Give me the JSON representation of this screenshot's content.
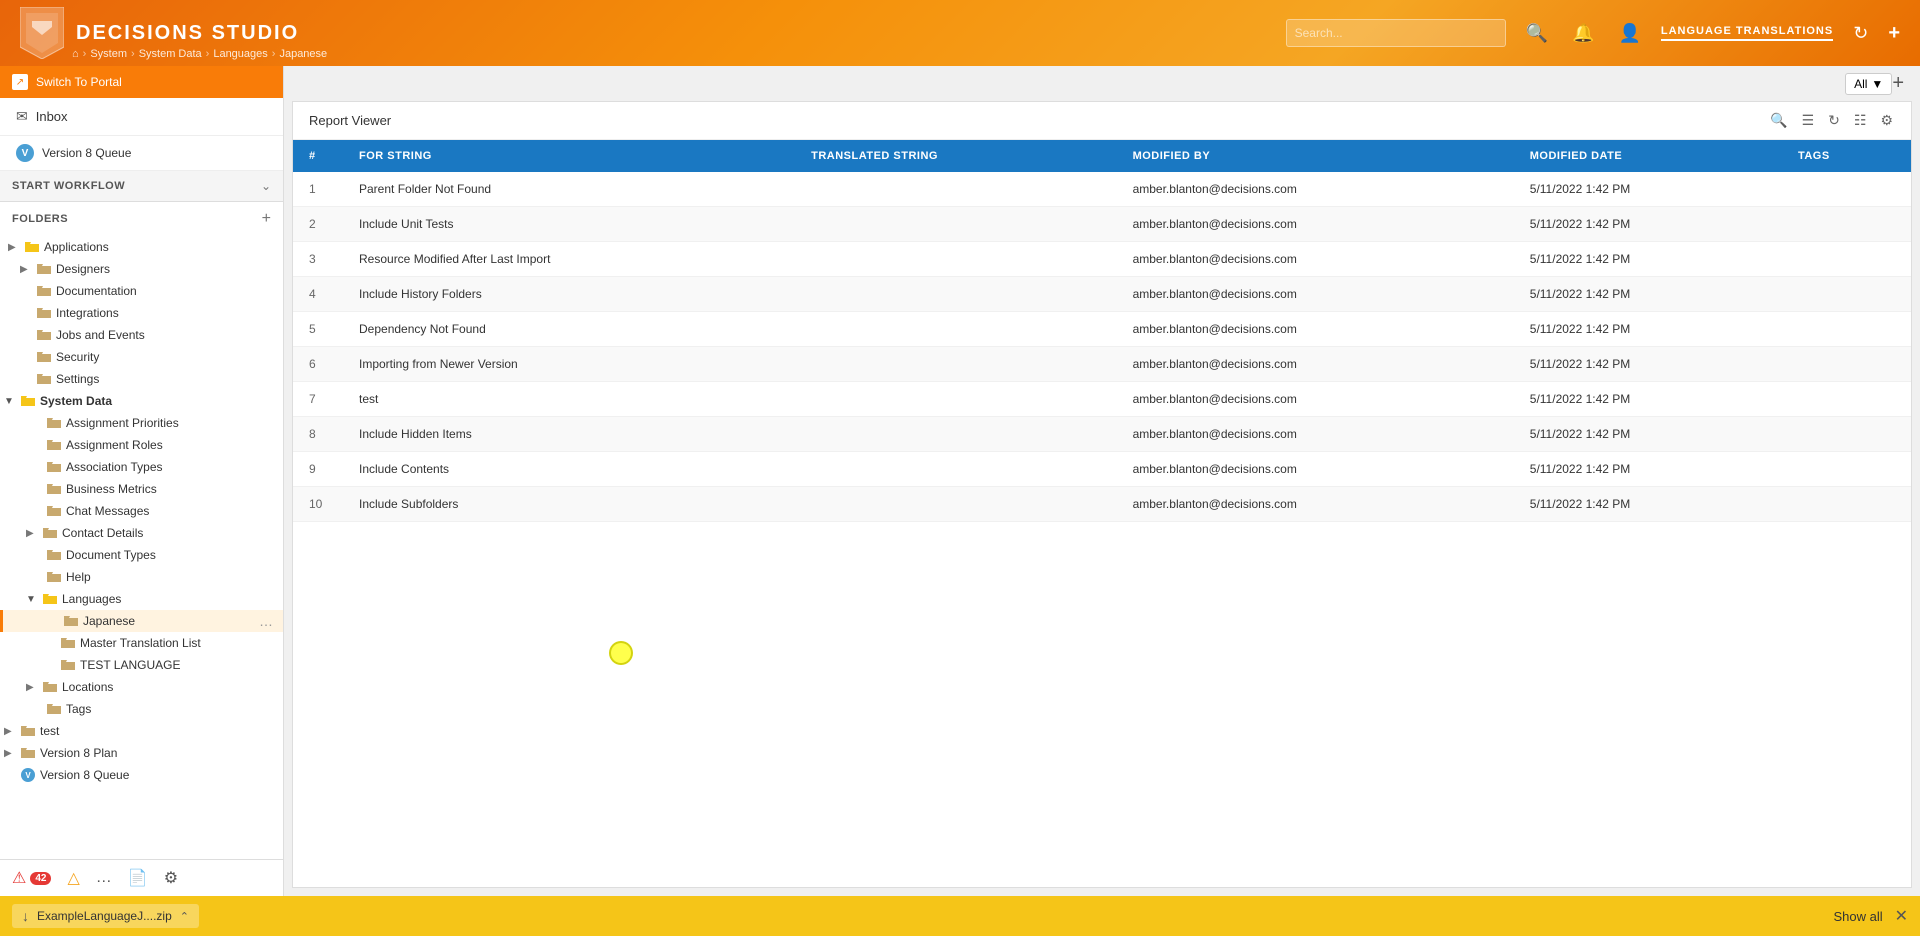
{
  "app": {
    "title": "DECISIONS STUDIO"
  },
  "header": {
    "title": "DECISIONS STUDIO",
    "search_placeholder": "Search...",
    "lang_translations_label": "LANGUAGE TRANSLATIONS",
    "all_label": "All",
    "refresh_icon": "↺"
  },
  "breadcrumb": {
    "home": "⌂",
    "system": "System",
    "system_data": "System Data",
    "languages": "Languages",
    "japanese": "Japanese"
  },
  "sidebar": {
    "switch_portal": "Switch To Portal",
    "inbox": "Inbox",
    "version_queue": "Version 8 Queue",
    "start_workflow": "START WORKFLOW",
    "folders_label": "FOLDERS",
    "items": [
      {
        "id": "applications",
        "label": "Applications",
        "level": 0,
        "expandable": true,
        "expanded": false
      },
      {
        "id": "designers",
        "label": "Designers",
        "level": 1,
        "expandable": true,
        "expanded": false
      },
      {
        "id": "documentation",
        "label": "Documentation",
        "level": 1,
        "expandable": false,
        "expanded": false
      },
      {
        "id": "integrations",
        "label": "Integrations",
        "level": 1,
        "expandable": false,
        "expanded": false
      },
      {
        "id": "jobs-events",
        "label": "Jobs and Events",
        "level": 1,
        "expandable": false,
        "expanded": false
      },
      {
        "id": "security",
        "label": "Security",
        "level": 1,
        "expandable": false,
        "expanded": false
      },
      {
        "id": "settings",
        "label": "Settings",
        "level": 1,
        "expandable": false,
        "expanded": false
      },
      {
        "id": "system-data",
        "label": "System Data",
        "level": 1,
        "expandable": true,
        "expanded": true
      },
      {
        "id": "assignment-priorities",
        "label": "Assignment Priorities",
        "level": 2,
        "expandable": false
      },
      {
        "id": "assignment-roles",
        "label": "Assignment Roles",
        "level": 2,
        "expandable": false
      },
      {
        "id": "association-types",
        "label": "Association Types",
        "level": 2,
        "expandable": false
      },
      {
        "id": "business-metrics",
        "label": "Business Metrics",
        "level": 2,
        "expandable": false
      },
      {
        "id": "chat-messages",
        "label": "Chat Messages",
        "level": 2,
        "expandable": false
      },
      {
        "id": "contact-details",
        "label": "Contact Details",
        "level": 2,
        "expandable": true,
        "expanded": false
      },
      {
        "id": "document-types",
        "label": "Document Types",
        "level": 2,
        "expandable": false
      },
      {
        "id": "help",
        "label": "Help",
        "level": 2,
        "expandable": false
      },
      {
        "id": "languages",
        "label": "Languages",
        "level": 2,
        "expandable": true,
        "expanded": true
      },
      {
        "id": "japanese",
        "label": "Japanese",
        "level": 3,
        "expandable": false,
        "active": true
      },
      {
        "id": "master-translation",
        "label": "Master Translation List",
        "level": 3,
        "expandable": false
      },
      {
        "id": "test-language",
        "label": "TEST LANGUAGE",
        "level": 3,
        "expandable": false
      },
      {
        "id": "locations",
        "label": "Locations",
        "level": 2,
        "expandable": true,
        "expanded": false
      },
      {
        "id": "tags",
        "label": "Tags",
        "level": 2,
        "expandable": false
      }
    ],
    "bottom_items": [
      {
        "id": "test",
        "label": "test",
        "expandable": true
      },
      {
        "id": "version8plan",
        "label": "Version 8 Plan",
        "expandable": true
      },
      {
        "id": "version8queue",
        "label": "Version 8 Queue",
        "expandable": false
      }
    ],
    "status_bar": {
      "error_count": "42",
      "has_warning": true,
      "has_chat": true,
      "has_doc": true,
      "has_settings": true
    }
  },
  "report": {
    "title": "Report Viewer",
    "columns": [
      "FOR STRING",
      "TRANSLATED STRING",
      "MODIFIED BY",
      "MODIFIED DATE",
      "TAGS"
    ],
    "rows": [
      {
        "num": "1",
        "for_string": "Parent Folder Not Found",
        "translated_string": "",
        "modified_by": "amber.blanton@decisions.com",
        "modified_date": "5/11/2022 1:42 PM",
        "tags": ""
      },
      {
        "num": "2",
        "for_string": "Include Unit Tests",
        "translated_string": "",
        "modified_by": "amber.blanton@decisions.com",
        "modified_date": "5/11/2022 1:42 PM",
        "tags": ""
      },
      {
        "num": "3",
        "for_string": "Resource Modified After Last Import",
        "translated_string": "",
        "modified_by": "amber.blanton@decisions.com",
        "modified_date": "5/11/2022 1:42 PM",
        "tags": ""
      },
      {
        "num": "4",
        "for_string": "Include History Folders",
        "translated_string": "",
        "modified_by": "amber.blanton@decisions.com",
        "modified_date": "5/11/2022 1:42 PM",
        "tags": ""
      },
      {
        "num": "5",
        "for_string": "Dependency Not Found",
        "translated_string": "",
        "modified_by": "amber.blanton@decisions.com",
        "modified_date": "5/11/2022 1:42 PM",
        "tags": ""
      },
      {
        "num": "6",
        "for_string": "Importing from Newer Version",
        "translated_string": "",
        "modified_by": "amber.blanton@decisions.com",
        "modified_date": "5/11/2022 1:42 PM",
        "tags": ""
      },
      {
        "num": "7",
        "for_string": "test",
        "translated_string": "",
        "modified_by": "amber.blanton@decisions.com",
        "modified_date": "5/11/2022 1:42 PM",
        "tags": ""
      },
      {
        "num": "8",
        "for_string": "Include Hidden Items",
        "translated_string": "",
        "modified_by": "amber.blanton@decisions.com",
        "modified_date": "5/11/2022 1:42 PM",
        "tags": ""
      },
      {
        "num": "9",
        "for_string": "Include Contents",
        "translated_string": "",
        "modified_by": "amber.blanton@decisions.com",
        "modified_date": "5/11/2022 1:42 PM",
        "tags": ""
      },
      {
        "num": "10",
        "for_string": "Include Subfolders",
        "translated_string": "",
        "modified_by": "amber.blanton@decisions.com",
        "modified_date": "5/11/2022 1:42 PM",
        "tags": ""
      }
    ]
  },
  "bottom_bar": {
    "filename": "ExampleLanguageJ....zip",
    "show_all_label": "Show all"
  }
}
